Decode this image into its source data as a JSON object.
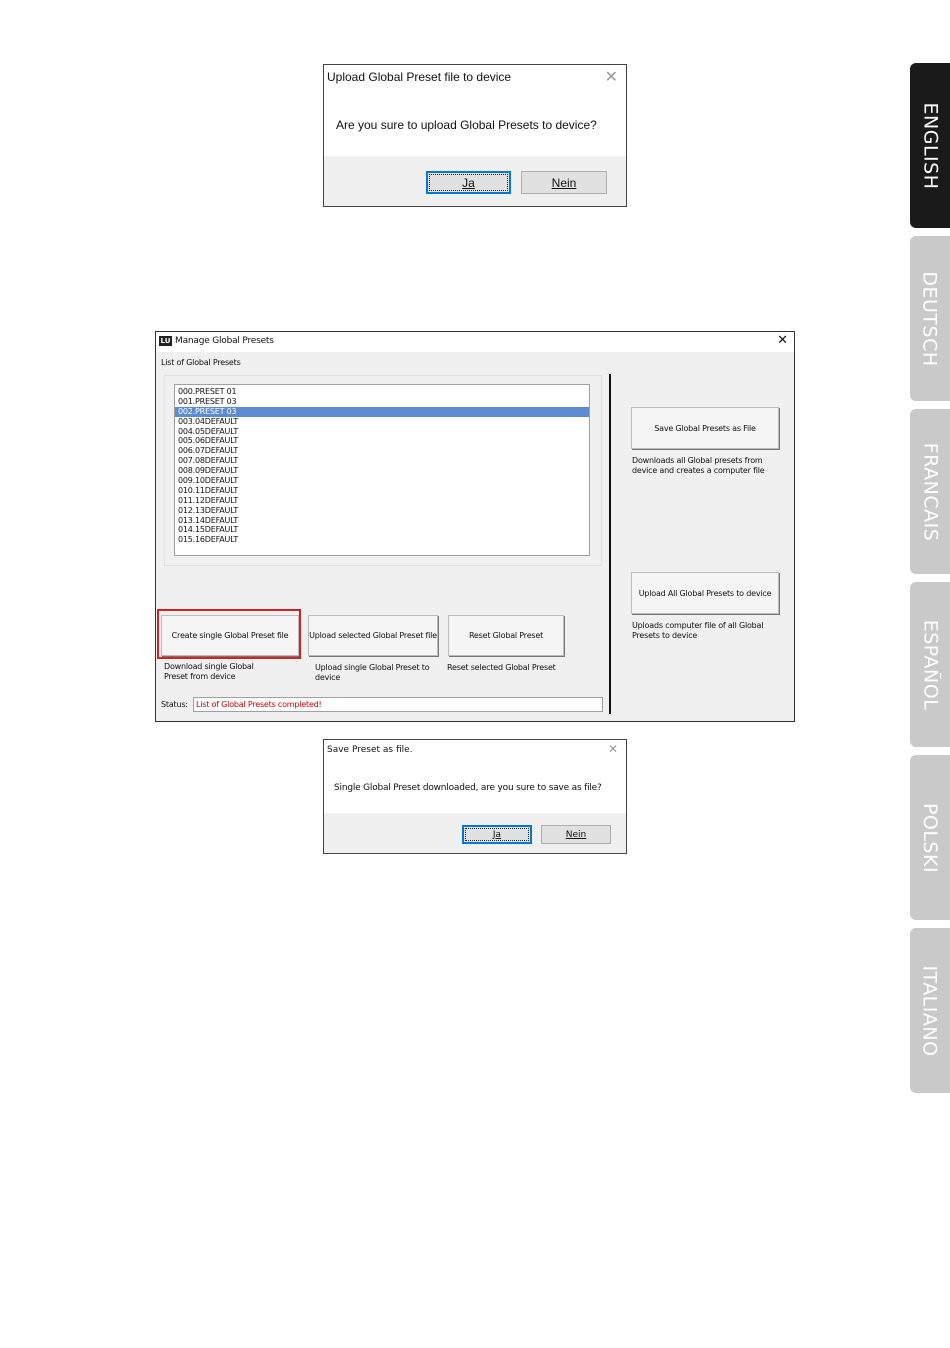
{
  "languages": [
    {
      "label": "ENGLISH",
      "active": true
    },
    {
      "label": "DEUTSCH",
      "active": false
    },
    {
      "label": "FRANCAIS",
      "active": false
    },
    {
      "label": "ESPAÑOL",
      "active": false
    },
    {
      "label": "POLSKI",
      "active": false
    },
    {
      "label": "ITALIANO",
      "active": false
    }
  ],
  "upload_dialog": {
    "title": "Upload Global Preset file to device",
    "message": "Are you sure to upload Global Presets to device?",
    "yes": "Ja",
    "no": "Nein"
  },
  "manage_window": {
    "title": "Manage Global Presets",
    "list_label": "List of Global Presets",
    "presets": [
      "000.PRESET 01",
      "001.PRESET 03",
      "002.PRESET 03",
      "003.04DEFAULT",
      "004.05DEFAULT",
      "005.06DEFAULT",
      "006.07DEFAULT",
      "007.08DEFAULT",
      "008.09DEFAULT",
      "009.10DEFAULT",
      "010.11DEFAULT",
      "011.12DEFAULT",
      "012.13DEFAULT",
      "013.14DEFAULT",
      "014.15DEFAULT",
      "015.16DEFAULT"
    ],
    "selected_index": 2,
    "buttons": {
      "create_single": "Create single Global Preset file",
      "upload_selected": "Upload selected Global Preset file",
      "reset_selected": "Reset Global Preset",
      "save_all": "Save Global Presets as File",
      "upload_all": "Upload All Global Presets to device"
    },
    "descriptions": {
      "create_single_1": "Download single Global",
      "create_single_2": "Preset from device",
      "upload_selected_1": "Upload single Global Preset to",
      "upload_selected_2": "device",
      "reset_selected": "Reset selected Global Preset",
      "save_all_1": "Downloads all Global presets from",
      "save_all_2": "device and creates a computer file",
      "upload_all_1": "Uploads computer file of all Global",
      "upload_all_2": "Presets to device"
    },
    "status_label": "Status:",
    "status_value": "List of Global Presets completed!",
    "status_color": "#cc0000",
    "highlight_color": "#d42020",
    "icon_text": "LU"
  },
  "save_dialog": {
    "title": "Save Preset as file.",
    "message": "Single Global Preset downloaded, are you sure to save as file?",
    "yes": "Ja",
    "no": "Nein"
  }
}
